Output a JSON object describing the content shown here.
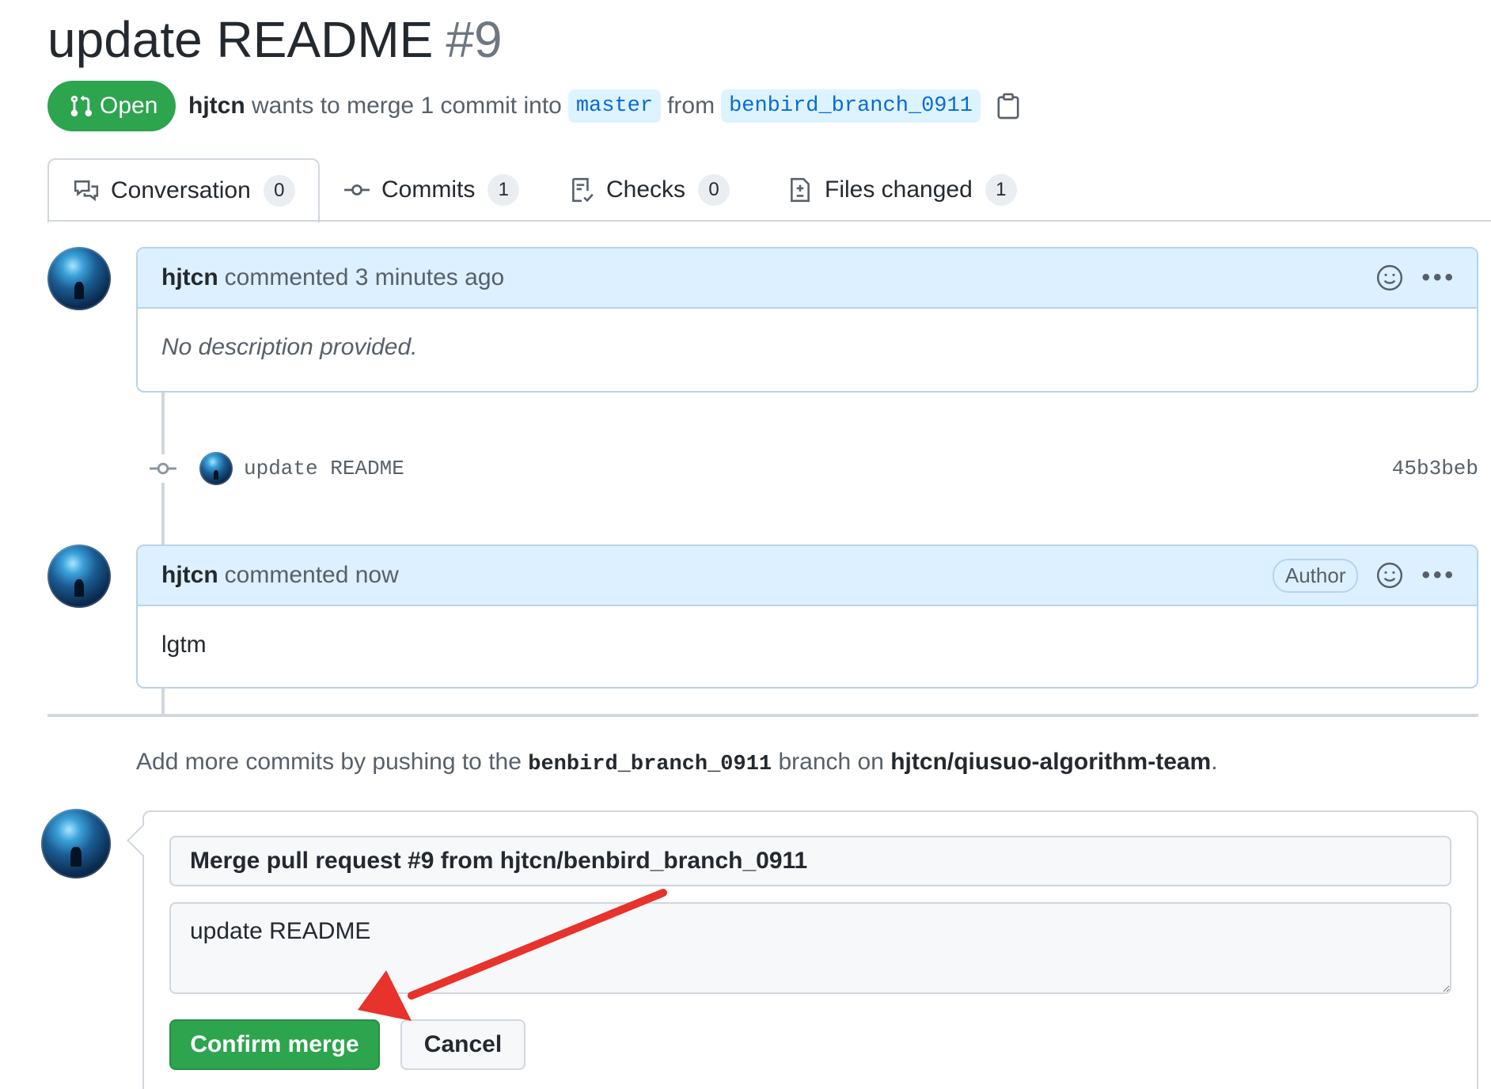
{
  "pr": {
    "title": "update README",
    "number": "#9",
    "status": "Open",
    "author": "hjtcn",
    "merge_text": "wants to merge 1 commit into",
    "base_branch": "master",
    "from_text": "from",
    "head_branch": "benbird_branch_0911"
  },
  "tabs": [
    {
      "label": "Conversation",
      "count": "0",
      "icon": "comment-discussion-icon"
    },
    {
      "label": "Commits",
      "count": "1",
      "icon": "git-commit-icon"
    },
    {
      "label": "Checks",
      "count": "0",
      "icon": "checklist-icon"
    },
    {
      "label": "Files changed",
      "count": "1",
      "icon": "file-diff-icon"
    }
  ],
  "comments": [
    {
      "author": "hjtcn",
      "action": "commented 3 minutes ago",
      "body": "No description provided."
    },
    {
      "author": "hjtcn",
      "action": "commented now",
      "badge": "Author",
      "body": "lgtm"
    }
  ],
  "commit": {
    "message": "update README",
    "sha": "45b3beb"
  },
  "hint": {
    "prefix": "Add more commits by pushing to the",
    "branch": "benbird_branch_0911",
    "middle": "branch on",
    "repo": "hjtcn/qiusuo-algorithm-team",
    "suffix": "."
  },
  "merge": {
    "title_value": "Merge pull request #9 from hjtcn/benbird_branch_0911",
    "message_value": "update README",
    "confirm_label": "Confirm merge",
    "cancel_label": "Cancel"
  },
  "colors": {
    "accent_green": "#2da44e",
    "link_blue": "#0969da",
    "annotation_arrow": "#e8322c"
  }
}
